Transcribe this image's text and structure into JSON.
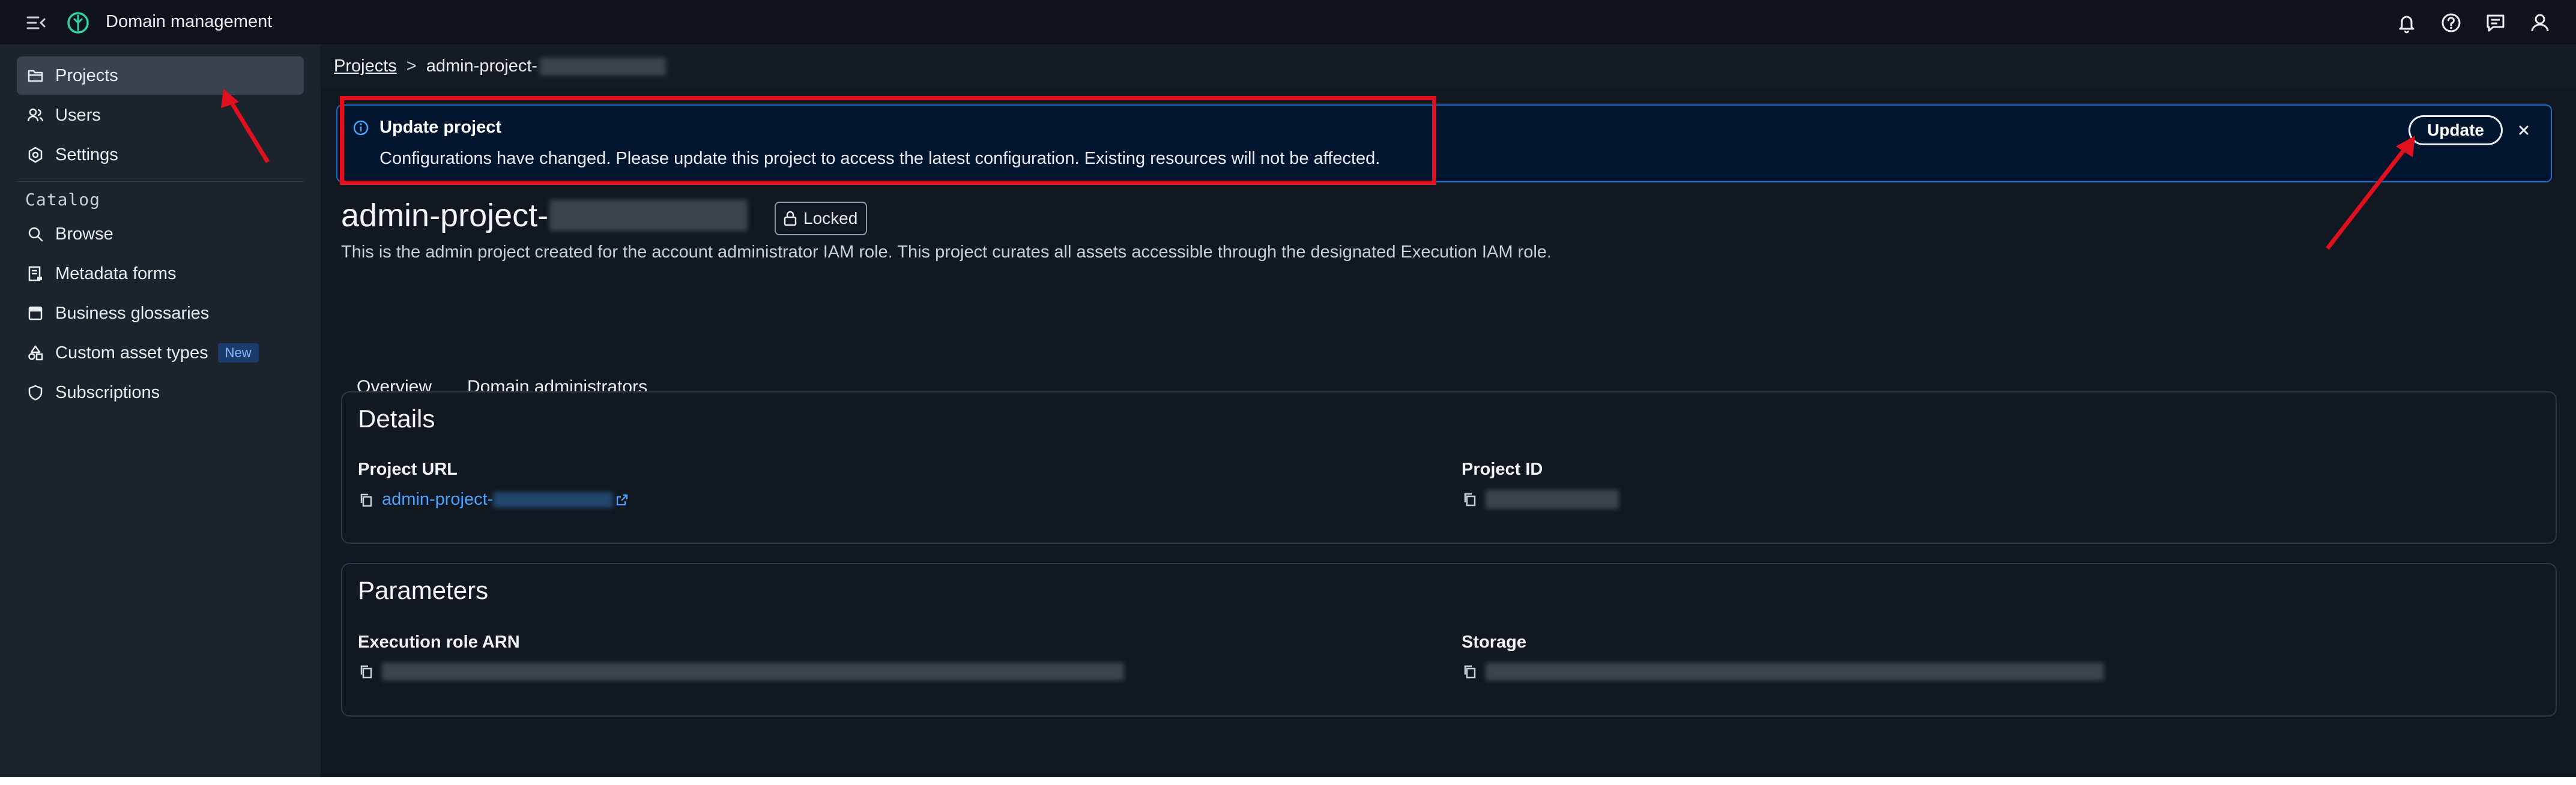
{
  "app": {
    "title": "Domain management"
  },
  "topbar": {
    "icons": [
      "notifications-icon",
      "help-icon",
      "feedback-icon",
      "user-icon"
    ]
  },
  "sidebar": {
    "items": [
      {
        "label": "Projects",
        "icon": "folder-icon",
        "active": true
      },
      {
        "label": "Users",
        "icon": "users-icon"
      },
      {
        "label": "Settings",
        "icon": "settings-icon"
      }
    ],
    "catalog_heading": "Catalog",
    "catalog_items": [
      {
        "label": "Browse",
        "icon": "search-icon"
      },
      {
        "label": "Metadata forms",
        "icon": "form-icon"
      },
      {
        "label": "Business glossaries",
        "icon": "book-icon"
      },
      {
        "label": "Custom asset types",
        "icon": "asset-types-icon",
        "badge": "New"
      },
      {
        "label": "Subscriptions",
        "icon": "shield-icon"
      }
    ]
  },
  "breadcrumb": {
    "root": "Projects",
    "separator": ">",
    "current": "admin-project-"
  },
  "flash": {
    "title": "Update project",
    "message": "Configurations have changed. Please update this project to access the latest configuration. Existing resources will not be affected.",
    "button": "Update",
    "close": "×"
  },
  "project": {
    "name": "admin-project-",
    "status": "Locked",
    "description": "This is the admin project created for the account administrator IAM role. This project curates all assets accessible through the designated Execution IAM role."
  },
  "tabs": [
    {
      "label": "Overview",
      "active": true
    },
    {
      "label": "Domain administrators",
      "active": false
    }
  ],
  "details": {
    "title": "Details",
    "project_url_label": "Project URL",
    "project_url_value": "admin-project-",
    "project_id_label": "Project ID"
  },
  "parameters": {
    "title": "Parameters",
    "execution_role_label": "Execution role ARN",
    "storage_label": "Storage"
  },
  "colors": {
    "accent": "#4aa3ff",
    "highlight": "#e0101e",
    "banner_border": "#1d6bc9"
  }
}
